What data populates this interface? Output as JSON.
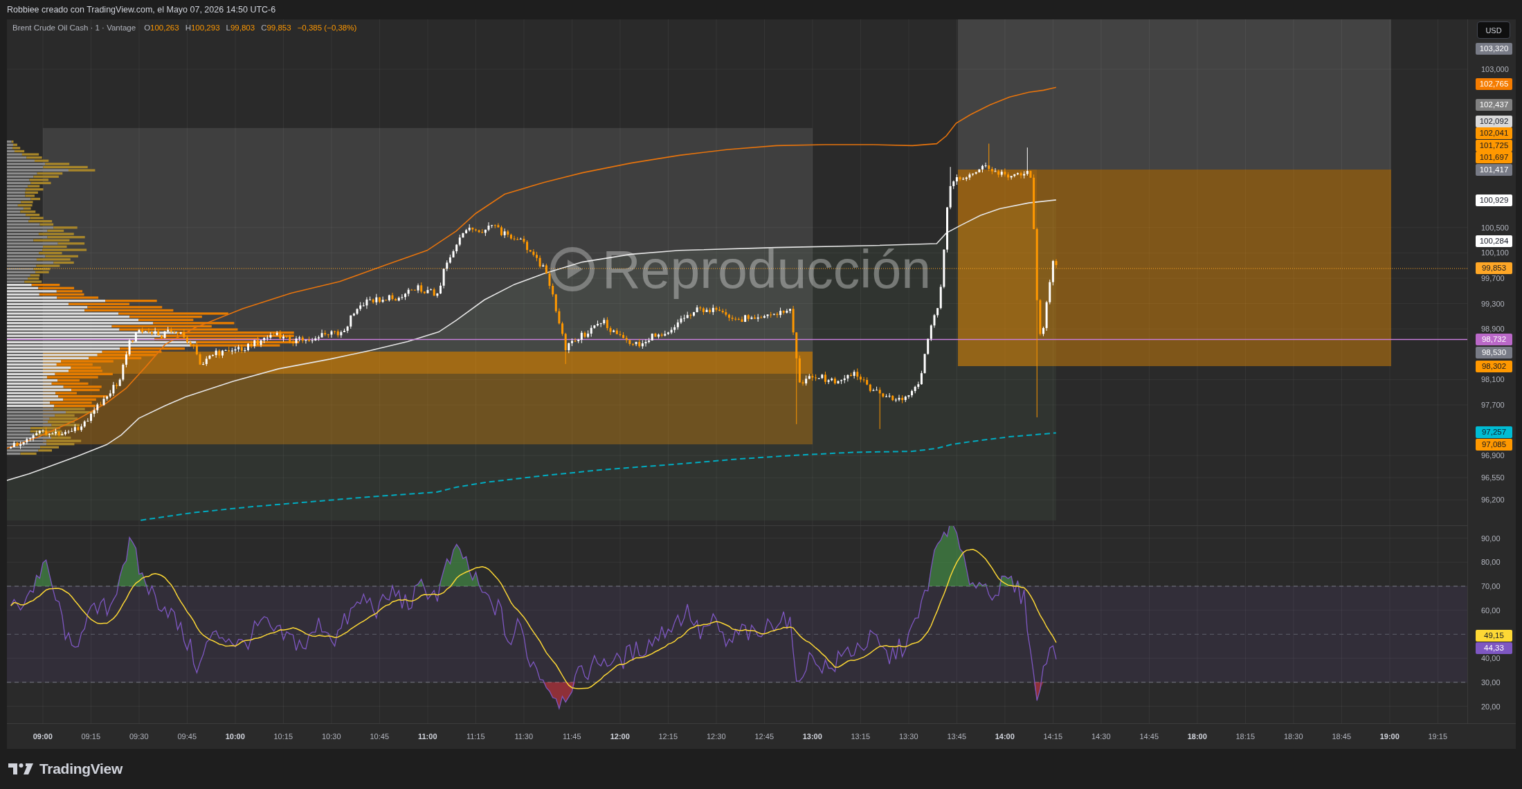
{
  "header": {
    "text": "Robbiee creado con TradingView.com, el Mayo 07, 2026 14:50 UTC-6"
  },
  "legend": {
    "title": "Brent Crude Oil Cash · 1 · Vantage",
    "ohlc": [
      {
        "label": "O",
        "value": "100,263"
      },
      {
        "label": "H",
        "value": "100,293"
      },
      {
        "label": "L",
        "value": "99,803"
      },
      {
        "label": "C",
        "value": "99,853"
      }
    ],
    "change": "−0,385 (−0,38%)"
  },
  "currency_button": {
    "label": "USD"
  },
  "replay_overlay": {
    "label": "Reproducción"
  },
  "price_axis": {
    "ticks": [
      "103,000",
      "100,500",
      "100,100",
      "99,700",
      "99,300",
      "98,900",
      "98,100",
      "97,700",
      "96,900",
      "96,550",
      "96,200"
    ],
    "tags": [
      {
        "value": "103,320",
        "color": "#787b86"
      },
      {
        "value": "102,765",
        "color": "#f57c00"
      },
      {
        "value": "102,437",
        "color": "#808080"
      },
      {
        "value": "102,092",
        "color": "#d9d9d9"
      },
      {
        "value": "102,041",
        "color": "#ff9800"
      },
      {
        "value": "101,725",
        "color": "#ff9800"
      },
      {
        "value": "101,697",
        "color": "#ff9800"
      },
      {
        "value": "101,417",
        "color": "#787b86"
      },
      {
        "value": "100,929",
        "color": "#ffffff"
      },
      {
        "value": "100,284",
        "color": "#ffffff"
      },
      {
        "value": "99,853",
        "color": "#ffa726"
      },
      {
        "value": "98,732",
        "color": "#ba68c8"
      },
      {
        "value": "98,530",
        "color": "#787b86"
      },
      {
        "value": "98,302",
        "color": "#ff9800"
      },
      {
        "value": "97,257",
        "color": "#00bcd4"
      },
      {
        "value": "97,085",
        "color": "#ff9800"
      }
    ]
  },
  "rsi_axis": {
    "ticks": [
      "90,00",
      "80,00",
      "70,00",
      "60,00",
      "40,00",
      "30,00",
      "20,00"
    ],
    "tags": [
      {
        "value": "49,15",
        "color": "#fdd835"
      },
      {
        "value": "44,33",
        "color": "#7e57c2"
      }
    ]
  },
  "time_axis": {
    "ticks": [
      {
        "label": "09:00",
        "major": true
      },
      {
        "label": "09:15",
        "major": false
      },
      {
        "label": "09:30",
        "major": false
      },
      {
        "label": "09:45",
        "major": false
      },
      {
        "label": "10:00",
        "major": true
      },
      {
        "label": "10:15",
        "major": false
      },
      {
        "label": "10:30",
        "major": false
      },
      {
        "label": "10:45",
        "major": false
      },
      {
        "label": "11:00",
        "major": true
      },
      {
        "label": "11:15",
        "major": false
      },
      {
        "label": "11:30",
        "major": false
      },
      {
        "label": "11:45",
        "major": false
      },
      {
        "label": "12:00",
        "major": true
      },
      {
        "label": "12:15",
        "major": false
      },
      {
        "label": "12:30",
        "major": false
      },
      {
        "label": "12:45",
        "major": false
      },
      {
        "label": "13:00",
        "major": true
      },
      {
        "label": "13:15",
        "major": false
      },
      {
        "label": "13:30",
        "major": false
      },
      {
        "label": "13:45",
        "major": false
      },
      {
        "label": "14:00",
        "major": true
      },
      {
        "label": "14:15",
        "major": false
      },
      {
        "label": "14:30",
        "major": false
      },
      {
        "label": "14:45",
        "major": false
      },
      {
        "label": "18:00",
        "major": true
      },
      {
        "label": "18:15",
        "major": false
      },
      {
        "label": "18:30",
        "major": false
      },
      {
        "label": "18:45",
        "major": false
      },
      {
        "label": "19:00",
        "major": true
      },
      {
        "label": "19:15",
        "major": false
      }
    ]
  },
  "footer": {
    "logo_text": "TradingView"
  }
}
